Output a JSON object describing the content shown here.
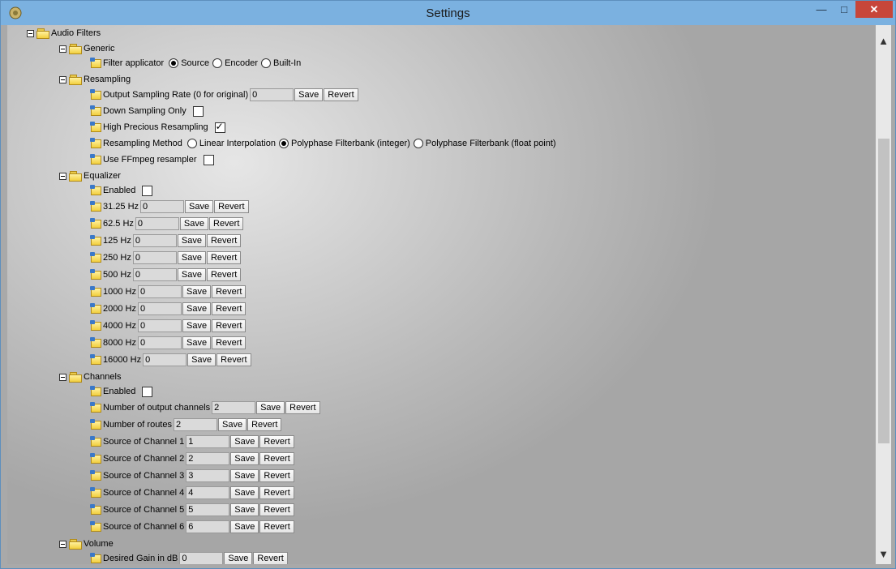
{
  "window": {
    "title": "Settings",
    "min": "—",
    "max": "□",
    "close": "✕"
  },
  "scrollbar": {
    "up": "▲",
    "down": "▼"
  },
  "tree": {
    "root": "Audio Filters",
    "generic": {
      "label": "Generic",
      "filter_applicator": {
        "label": "Filter applicator",
        "options": [
          "Source",
          "Encoder",
          "Built-In"
        ],
        "selected": "Source"
      }
    },
    "resampling": {
      "label": "Resampling",
      "output_rate": {
        "label": "Output Sampling Rate (0 for original)",
        "value": "0"
      },
      "down_sampling_only": {
        "label": "Down Sampling Only",
        "checked": false
      },
      "high_precious": {
        "label": "High Precious Resampling",
        "checked": true
      },
      "method": {
        "label": "Resampling Method",
        "options": [
          "Linear Interpolation",
          "Polyphase Filterbank (integer)",
          "Polyphase Filterbank (float point)"
        ],
        "selected": "Polyphase Filterbank (integer)"
      },
      "use_ffmpeg": {
        "label": "Use FFmpeg resampler",
        "checked": false
      }
    },
    "equalizer": {
      "label": "Equalizer",
      "enabled": {
        "label": "Enabled",
        "checked": false
      },
      "bands": [
        {
          "label": "31.25 Hz",
          "value": "0"
        },
        {
          "label": "62.5 Hz",
          "value": "0"
        },
        {
          "label": "125 Hz",
          "value": "0"
        },
        {
          "label": "250 Hz",
          "value": "0"
        },
        {
          "label": "500 Hz",
          "value": "0"
        },
        {
          "label": "1000 Hz",
          "value": "0"
        },
        {
          "label": "2000 Hz",
          "value": "0"
        },
        {
          "label": "4000 Hz",
          "value": "0"
        },
        {
          "label": "8000 Hz",
          "value": "0"
        },
        {
          "label": "16000 Hz",
          "value": "0"
        }
      ]
    },
    "channels": {
      "label": "Channels",
      "enabled": {
        "label": "Enabled",
        "checked": false
      },
      "output_channels": {
        "label": "Number of output channels",
        "value": "2"
      },
      "routes": {
        "label": "Number of routes",
        "value": "2"
      },
      "sources": [
        {
          "label": "Source of Channel 1",
          "value": "1"
        },
        {
          "label": "Source of Channel 2",
          "value": "2"
        },
        {
          "label": "Source of Channel 3",
          "value": "3"
        },
        {
          "label": "Source of Channel 4",
          "value": "4"
        },
        {
          "label": "Source of Channel 5",
          "value": "5"
        },
        {
          "label": "Source of Channel 6",
          "value": "6"
        }
      ]
    },
    "volume": {
      "label": "Volume",
      "desired_gain": {
        "label": "Desired Gain in dB",
        "value": "0"
      }
    }
  },
  "buttons": {
    "save": "Save",
    "revert": "Revert"
  }
}
